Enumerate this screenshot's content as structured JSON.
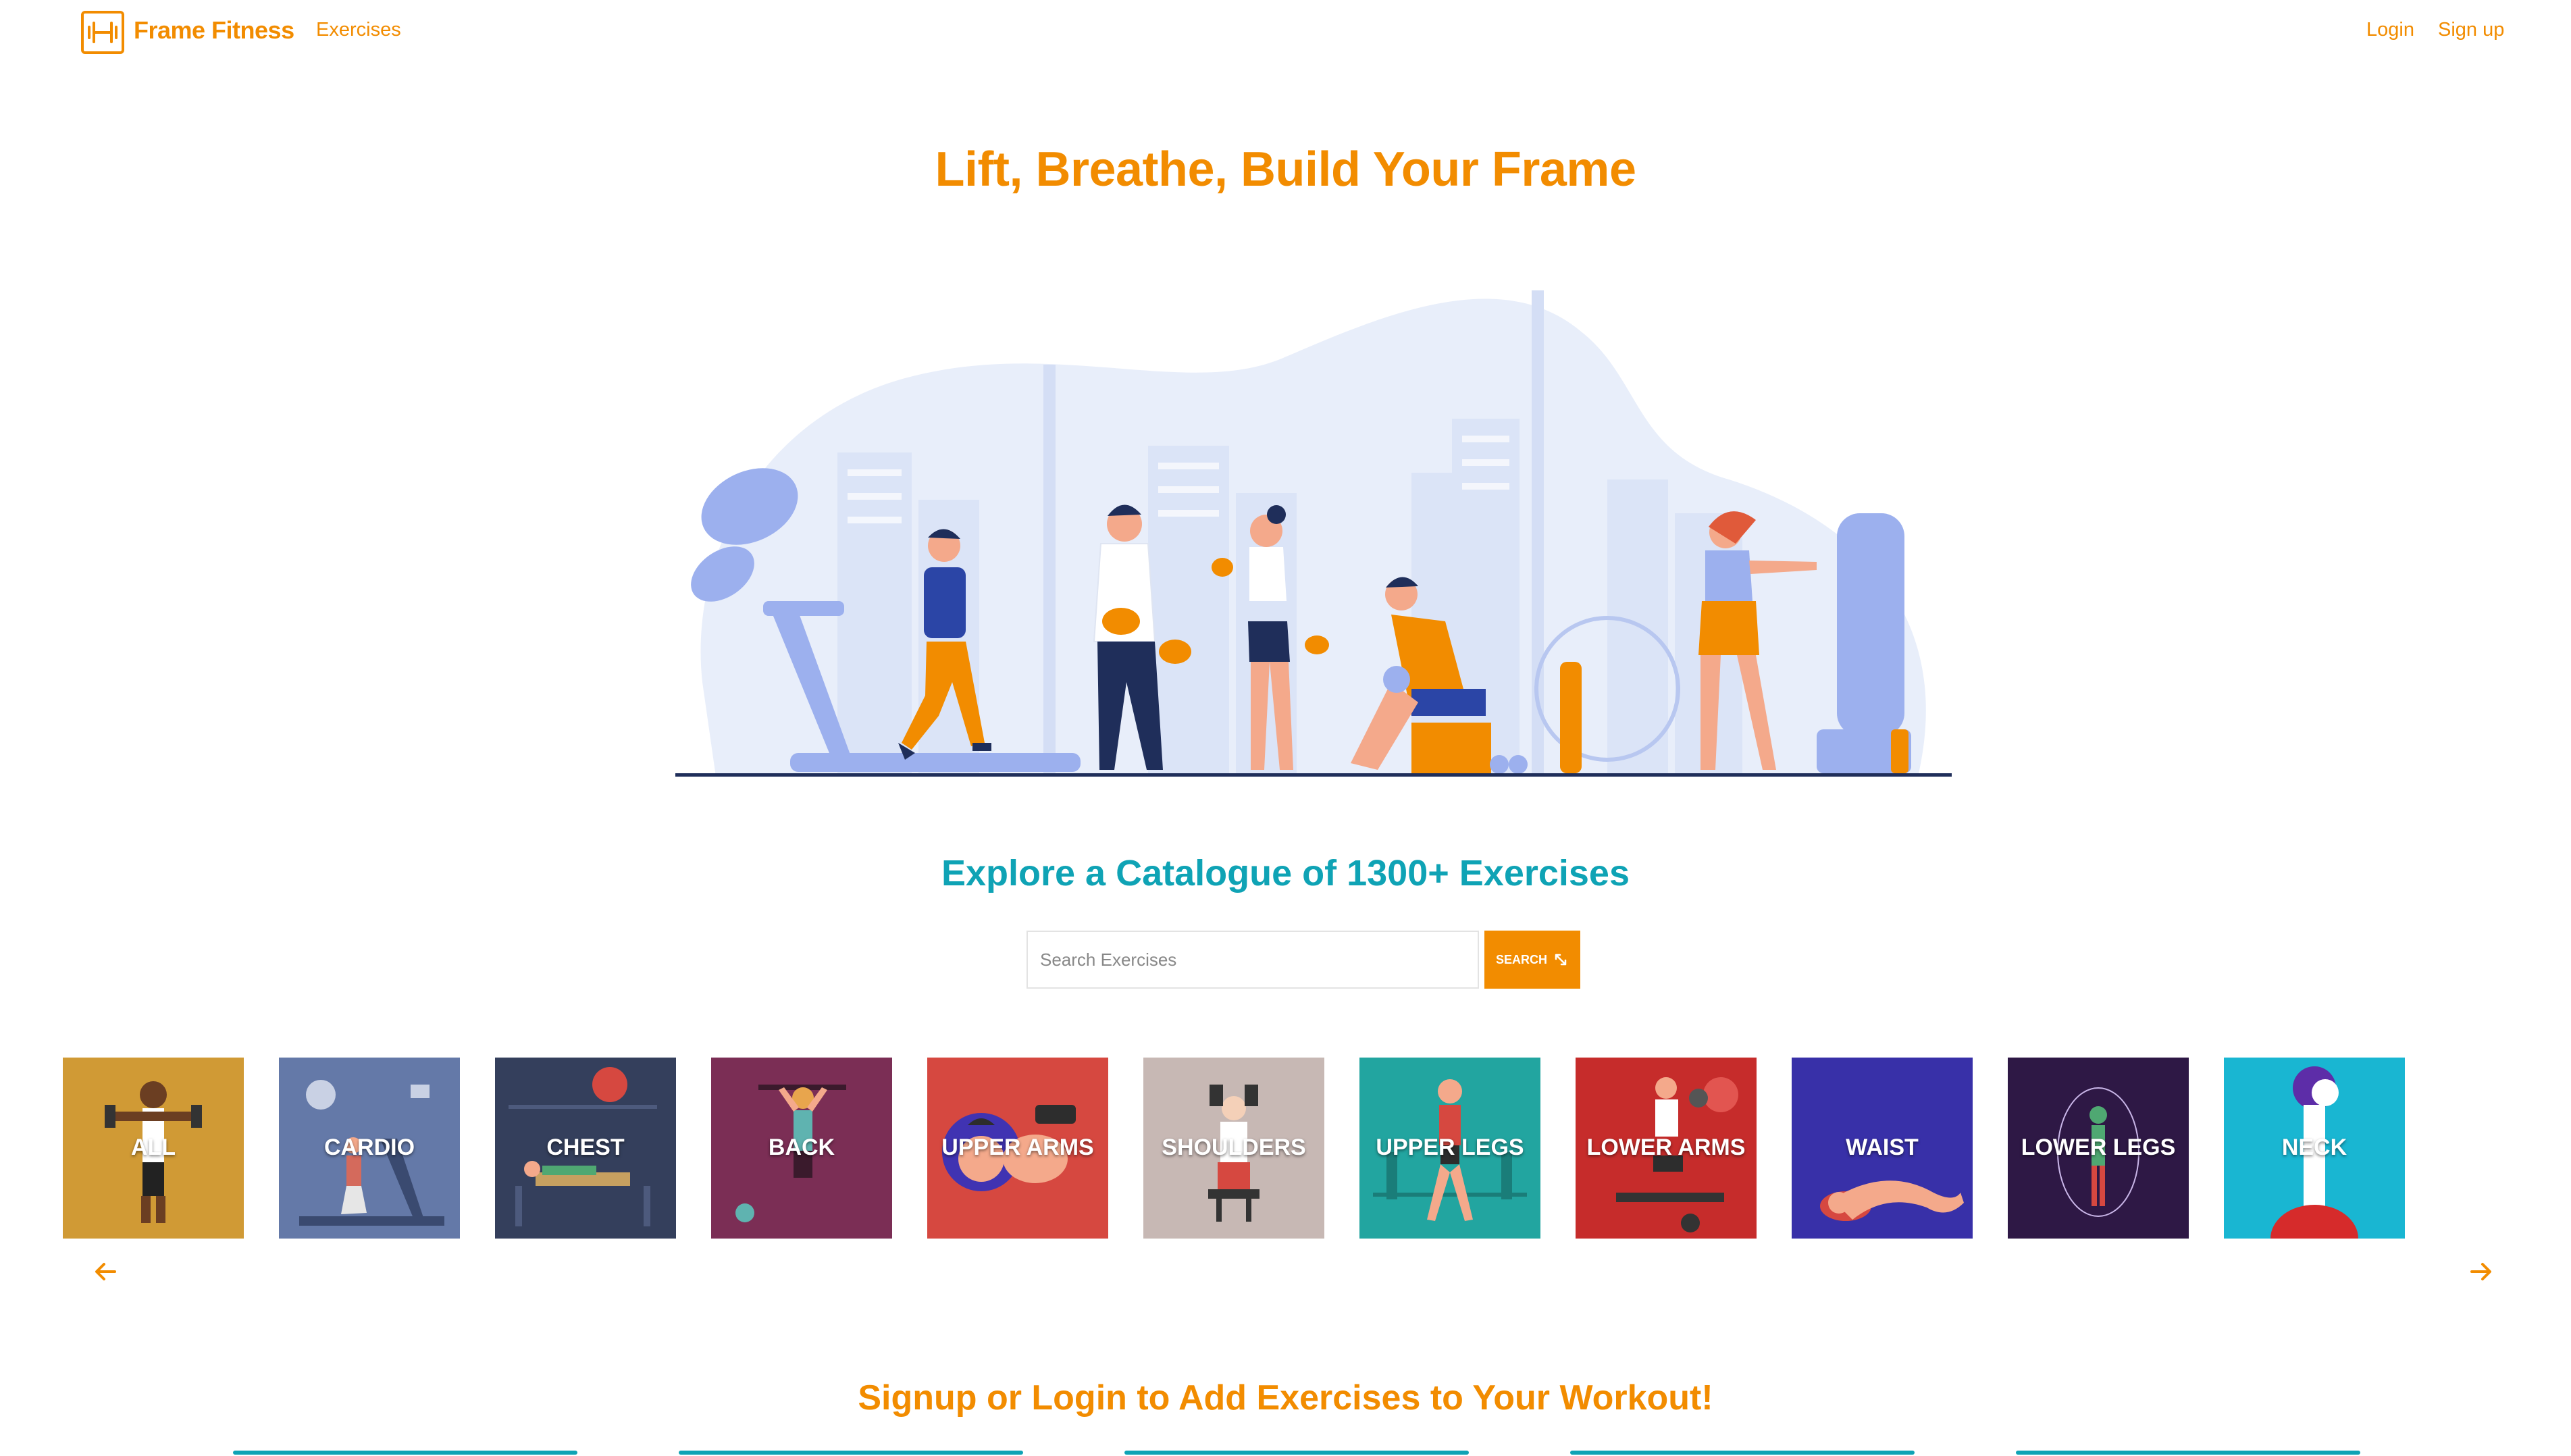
{
  "nav": {
    "brand": "Frame Fitness",
    "exercises_link": "Exercises",
    "login_link": "Login",
    "signup_link": "Sign up",
    "logo_icon": "dumbbell-icon"
  },
  "hero": {
    "title": "Lift, Breathe, Build Your Frame"
  },
  "catalogue": {
    "title": "Explore a Catalogue of 1300+ Exercises",
    "search_placeholder": "Search Exercises",
    "search_button": "SEARCH"
  },
  "categories": [
    {
      "label": "ALL",
      "color": "#d09a35"
    },
    {
      "label": "CARDIO",
      "color": "#6479a8"
    },
    {
      "label": "CHEST",
      "color": "#343f5c"
    },
    {
      "label": "BACK",
      "color": "#7b2e55"
    },
    {
      "label": "UPPER ARMS",
      "color": "#d64840"
    },
    {
      "label": "SHOULDERS",
      "color": "#c7b8b4"
    },
    {
      "label": "UPPER LEGS",
      "color": "#22a5a0"
    },
    {
      "label": "LOWER ARMS",
      "color": "#c62c2b"
    },
    {
      "label": "WAIST",
      "color": "#3830a8"
    },
    {
      "label": "LOWER LEGS",
      "color": "#2e1845"
    },
    {
      "label": "NECK",
      "color": "#19b6d2"
    }
  ],
  "cta": {
    "text": "Signup or Login to Add Exercises to Your Workout!"
  },
  "colors": {
    "accent": "#f28c00",
    "teal": "#0fa3b5"
  }
}
